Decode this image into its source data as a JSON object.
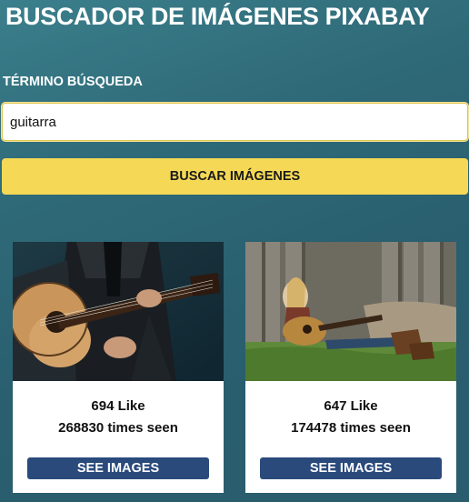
{
  "header": {
    "title": "BUSCADOR DE IMÁGENES PIXABAY"
  },
  "search": {
    "label": "TÉRMINO BÚSQUEDA",
    "value": "guitarra",
    "button_label": "BUSCAR IMÁGENES"
  },
  "results": [
    {
      "likes": "694 Like",
      "views": "268830 times seen",
      "button_label": "SEE IMAGES",
      "image": "man-playing-acoustic-guitar"
    },
    {
      "likes": "647 Like",
      "views": "174478 times seen",
      "button_label": "SEE IMAGES",
      "image": "woman-sitting-with-guitar"
    }
  ],
  "colors": {
    "accent_yellow": "#f5d956",
    "card_button": "#2a4a7c",
    "background": "#2f6a78"
  }
}
